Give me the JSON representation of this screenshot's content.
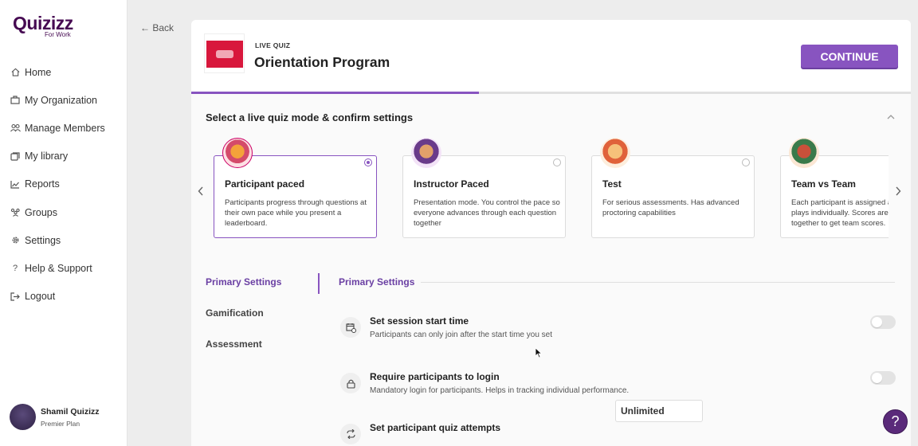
{
  "brand": {
    "logo": "Quizizz",
    "sub": "For Work",
    "accent": "#8854c0"
  },
  "nav": [
    {
      "label": "Home",
      "icon": "home-icon"
    },
    {
      "label": "My Organization",
      "icon": "building-icon"
    },
    {
      "label": "Manage Members",
      "icon": "users-icon"
    },
    {
      "label": "My library",
      "icon": "folder-icon"
    },
    {
      "label": "Reports",
      "icon": "chart-icon"
    },
    {
      "label": "Groups",
      "icon": "group-icon"
    },
    {
      "label": "Settings",
      "icon": "gear-icon"
    },
    {
      "label": "Help & Support",
      "icon": "question-icon"
    },
    {
      "label": "Logout",
      "icon": "logout-icon"
    }
  ],
  "profile": {
    "name": "Shamil Quizizz",
    "plan": "Premier Plan"
  },
  "back": {
    "label": "← Back"
  },
  "quiz": {
    "type": "LIVE QUIZ",
    "title": "Orientation Program",
    "progress": 0.4
  },
  "continue_label": "CONTINUE",
  "section_title": "Select a live quiz mode & confirm settings",
  "modes": [
    {
      "title": "Participant paced",
      "desc": "Participants progress through questions at their own pace while you present a leaderboard.",
      "selected": true
    },
    {
      "title": "Instructor Paced",
      "desc": "Presentation mode. You control the pace so everyone advances through each question together",
      "selected": false
    },
    {
      "title": "Test",
      "desc": "For serious assessments. Has advanced proctoring capabilities",
      "selected": false
    },
    {
      "title": "Team vs Team",
      "desc": "Each participant is assigned a team and plays individually. Scores are added together to get team scores.",
      "selected": false
    }
  ],
  "settings_nav": [
    "Primary Settings",
    "Gamification",
    "Assessment"
  ],
  "settings_heading": "Primary Settings",
  "settings": [
    {
      "title": "Set session start time",
      "desc": "Participants can only join after the start time you set",
      "icon": "calendar-clock-icon",
      "on": false
    },
    {
      "title": "Require participants to login",
      "desc": "Mandatory login for participants. Helps in tracking individual performance.",
      "icon": "lock-icon",
      "on": false
    },
    {
      "title": "Set participant quiz attempts",
      "desc": "",
      "icon": "repeat-icon",
      "value": "Unlimited"
    }
  ],
  "help_label": "?"
}
